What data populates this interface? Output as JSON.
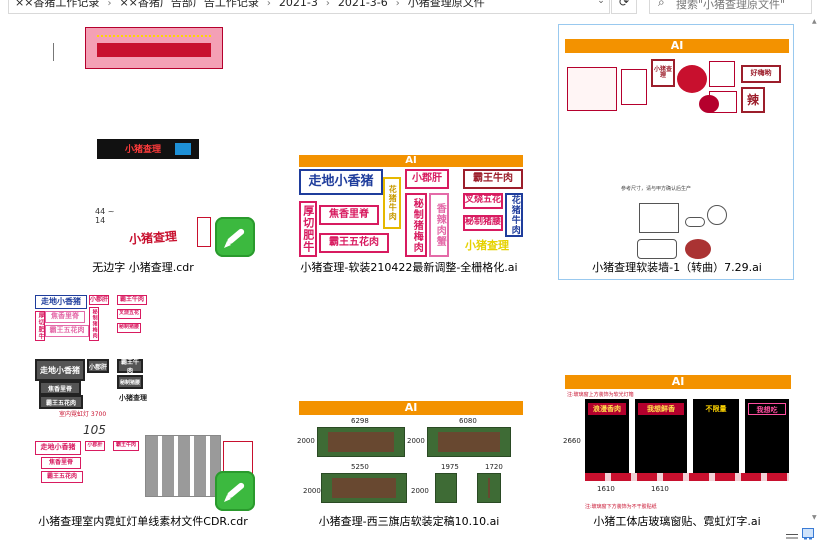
{
  "address_bar": {
    "crumbs": [
      "××香猪工作记录",
      "××香猪广告部广告工作记录",
      "2021-3",
      "2021-3-6",
      "小猪查理原文件"
    ]
  },
  "refresh_icon": "refresh-icon",
  "search": {
    "placeholder": "搜索\"小猪查理原文件\""
  },
  "files": [
    {
      "name": "无边字 小猪查理.cdr",
      "selected": false
    },
    {
      "name": "小猪查理-软装210422最新调整-全栅格化.ai",
      "selected": false
    },
    {
      "name": "小猪查理软装墙-1（转曲）7.29.ai",
      "selected": true
    },
    {
      "name": "小猪查理室内霓虹灯单线素材文件CDR.cdr",
      "selected": false
    },
    {
      "name": "小猪查理-西三旗店软装定稿10.10.ai",
      "selected": false
    },
    {
      "name": "小猪工体店玻璃窗贴、霓虹灯字.ai",
      "selected": false
    }
  ],
  "thumb_text": {
    "ai_banner": "AI",
    "t2_signs": [
      "走地小香猪",
      "小郡肝",
      "霸王牛肉",
      "厚切肥牛",
      "焦香里脊",
      "秘制猪梅肉",
      "香辣肉蟹",
      "叉烧五花",
      "花猪牛肉",
      "霸王五花肉",
      "秘制猪腰",
      "小猪查理"
    ],
    "t3_signs": [
      "小猪查理",
      "好嗨哟",
      "辣"
    ],
    "t3_caption": "参考尺寸，请与甲方确认后生产",
    "t4_caption": "室内霓虹灯 3700",
    "t4_handwritten": "105",
    "t5_dims": [
      "6298",
      "6080",
      "2000",
      "2000",
      "5250",
      "1975",
      "1720",
      "2000",
      "2000"
    ],
    "t6_dims": [
      "2660",
      "1610",
      "1610"
    ],
    "t6_top_note": "注:玻璃窗上方装饰为软光灯箱",
    "t6_bottom_note": "注:玻璃窗下方装饰为不干胶贴纸",
    "t6_panels": [
      "浪漫香肉",
      "我想鲜香",
      "不限量",
      "我想吃"
    ],
    "t1_logo": "小猪查理"
  },
  "colors": {
    "selection_border": "#99c9ef",
    "accent_orange": "#f39200",
    "sign_pink": "#d81b60",
    "sign_blue": "#1f3d9c"
  }
}
